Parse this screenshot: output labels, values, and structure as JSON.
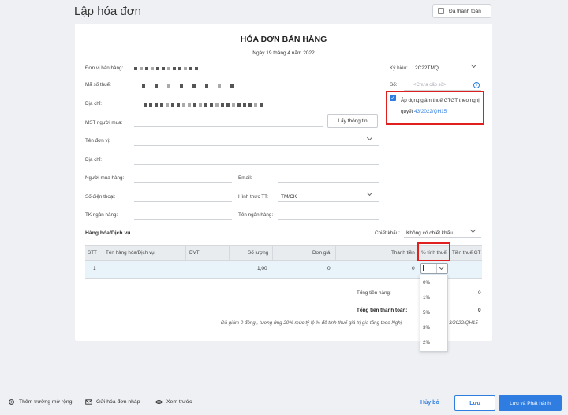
{
  "header": {
    "title": "Lập hóa đơn",
    "paid_label": "Đã thanh toán"
  },
  "invoice": {
    "title": "HÓA ĐƠN BÁN HÀNG",
    "date": "Ngày 19 tháng 4 năm 2022"
  },
  "form": {
    "seller_label": "Đơn vị bán hàng:",
    "tax_code_label": "Mã số thuế:",
    "address_label": "Địa chỉ:",
    "buyer_tax_label": "MST người mua:",
    "fetch_button": "Lấy thông tin",
    "unit_name_label": "Tên đơn vị:",
    "buyer_address_label": "Địa chỉ:",
    "buyer_label": "Người mua hàng:",
    "email_label": "Email:",
    "phone_label": "Số điện thoại:",
    "payment_label": "Hình thức TT:",
    "payment_value": "TM/CK",
    "bank_account_label": "TK ngân hàng:",
    "bank_name_label": "Tên ngân hàng:"
  },
  "side": {
    "symbol_label": "Ký hiệu:",
    "symbol_value": "2C22TMQ",
    "number_label": "Số:",
    "number_placeholder": "<Chưa cấp số>",
    "tax_reduction_text": "Áp dụng giảm thuế GTGT theo nghị quyết ",
    "tax_reduction_link": "43/2022/QH15"
  },
  "goods": {
    "title": "Hàng hóa/Dịch vụ",
    "discount_label": "Chiết khấu:",
    "discount_value": "Không có chiết khấu",
    "columns": [
      "STT",
      "Tên hàng hóa/Dịch vụ",
      "ĐVT",
      "Số lượng",
      "Đơn giá",
      "Thành tiền",
      "% tính thuế",
      "Tiền thuế GT"
    ],
    "row": {
      "stt": "1",
      "qty": "1,00",
      "price": "0",
      "amount": "0"
    },
    "tax_options": [
      "0%",
      "1%",
      "5%",
      "3%",
      "2%"
    ]
  },
  "totals": {
    "subtotal_label": "Tổng tiền hàng:",
    "subtotal_value": "0",
    "total_label": "Tổng tiền thanh toán:",
    "total_value": "0",
    "note": "Đã giảm 0 đồng , tương ứng 20% mức tỷ lệ % để tính thuế giá trị gia tăng theo Nghị",
    "note_tail": "3/2022/QH15"
  },
  "footer": {
    "extend_fields": "Thêm trường mở rộng",
    "send_draft": "Gửi hóa đơn nháp",
    "preview": "Xem trước",
    "cancel": "Hủy bỏ",
    "save": "Lưu",
    "save_issue": "Lưu và Phát hành"
  }
}
